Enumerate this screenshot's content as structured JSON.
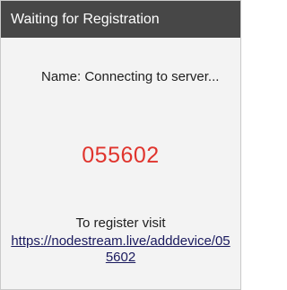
{
  "window": {
    "title": "Waiting for Registration"
  },
  "status": {
    "name_text": "Name: Connecting to server..."
  },
  "registration": {
    "code": "055602",
    "instruction": "To register visit",
    "url": "https://nodestream.live/adddevice/055602"
  },
  "colors": {
    "titlebar": "#474747",
    "code": "#e0342d",
    "background": "#f3f3f3"
  }
}
